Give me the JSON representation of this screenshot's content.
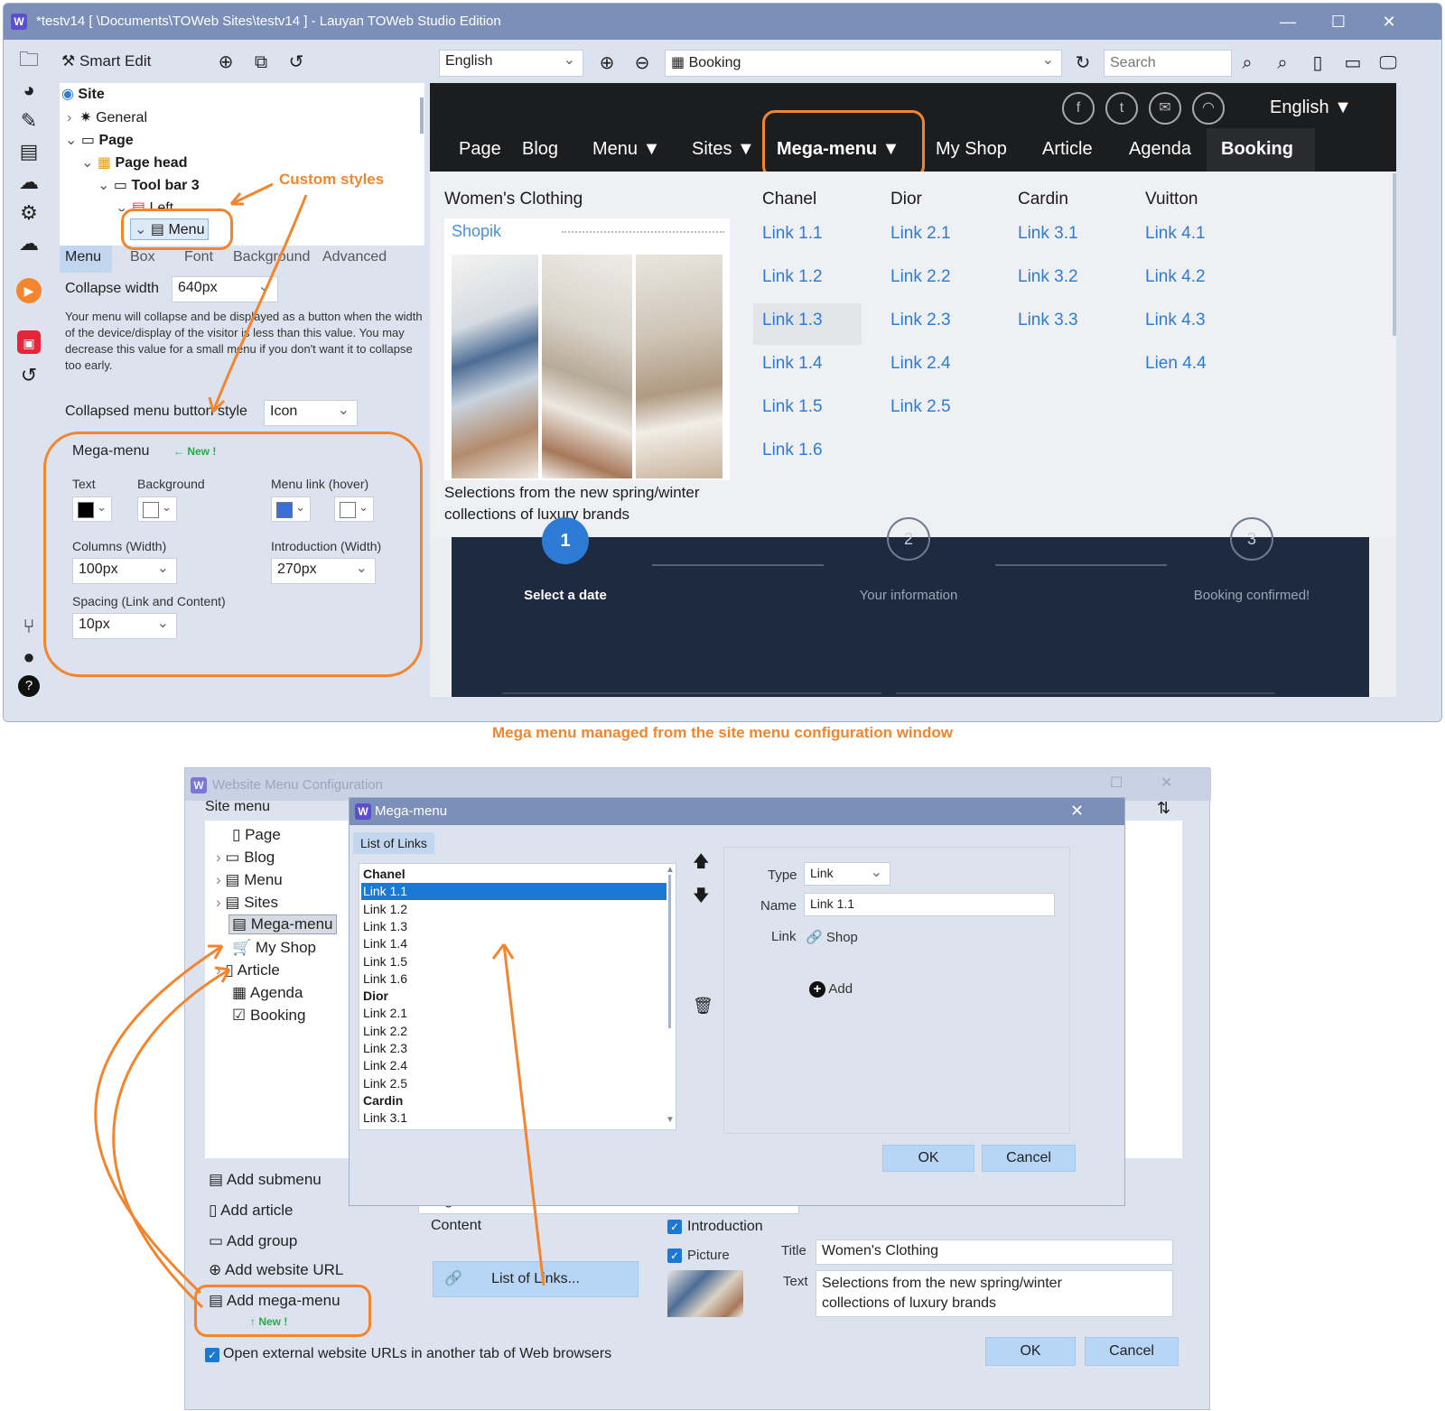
{
  "top_window": {
    "title": "*testv14 [ \\Documents\\TOWeb Sites\\testv14 ] - Lauyan TOWeb Studio Edition",
    "window_controls": [
      "—",
      "☐",
      "✕"
    ],
    "toolbar": {
      "smart_edit": "Smart Edit",
      "language": "English",
      "page_select": "Booking",
      "search_placeholder": "Search"
    },
    "tree": {
      "site": "Site",
      "general": "General",
      "page": "Page",
      "page_head": "Page head",
      "tool_bar": "Tool bar 3",
      "left": "Left",
      "menu": "Menu"
    },
    "tabs": [
      "Menu",
      "Box",
      "Font",
      "Background",
      "Advanced"
    ],
    "collapse_width_label": "Collapse width",
    "collapse_width_value": "640px",
    "collapse_help": "Your menu will collapse and be displayed as a button when the width of the device/display of the visitor is less than this value. You may decrease this value for a small menu if you don't want it to collapse too early.",
    "collapsed_style_label": "Collapsed menu button style",
    "collapsed_style_value": "Icon",
    "mega": {
      "title": "Mega-menu",
      "new_badge": "← New !",
      "text_label": "Text",
      "background_label": "Background",
      "hover_label": "Menu link (hover)",
      "columns_label": "Columns (Width)",
      "columns_value": "100px",
      "intro_label": "Introduction (Width)",
      "intro_value": "270px",
      "spacing_label": "Spacing (Link and Content)",
      "spacing_value": "10px",
      "colors": {
        "text": "#000000",
        "background": "#ffffff",
        "hover": "#3a6fd8",
        "hover_bg": "#ffffff"
      }
    },
    "annotation_custom_styles": "Custom styles"
  },
  "preview": {
    "language": "English ▼",
    "social_icons": [
      "facebook-icon",
      "twitter-icon",
      "mail-icon",
      "rss-icon"
    ],
    "nav": [
      "Page",
      "Blog",
      "Menu ▼",
      "Sites ▼",
      "Mega-menu ▼",
      "My Shop",
      "Article",
      "Agenda",
      "Booking"
    ],
    "intro_title": "Women's Clothing",
    "intro_brand": "Shopik",
    "intro_text_1": "Selections from the new spring/winter",
    "intro_text_2": "collections of luxury brands",
    "columns": [
      {
        "name": "Chanel",
        "links": [
          "Link 1.1",
          "Link 1.2",
          "Link 1.3",
          "Link 1.4",
          "Link 1.5",
          "Link 1.6"
        ]
      },
      {
        "name": "Dior",
        "links": [
          "Link 2.1",
          "Link 2.2",
          "Link 2.3",
          "Link 2.4",
          "Link 2.5"
        ]
      },
      {
        "name": "Cardin",
        "links": [
          "Link 3.1",
          "Link 3.2",
          "Link 3.3"
        ]
      },
      {
        "name": "Vuitton",
        "links": [
          "Link 4.1",
          "Link 4.2",
          "Link 4.3",
          "Lien 4.4"
        ]
      }
    ],
    "steps": [
      {
        "num": "1",
        "label": "Select a date"
      },
      {
        "num": "2",
        "label": "Your information"
      },
      {
        "num": "3",
        "label": "Booking confirmed!"
      }
    ],
    "accent": "#2e7bd6"
  },
  "caption": "Mega menu managed from the site menu configuration window",
  "config_window": {
    "title": "Website Menu Configuration",
    "site_menu_label": "Site menu",
    "site_menu": [
      "Page",
      "Blog",
      "Menu",
      "Sites",
      "Mega-menu",
      "My Shop",
      "Article",
      "Agenda",
      "Booking"
    ],
    "actions": [
      "Add submenu",
      "Add article",
      "Add group",
      "Add website URL",
      "Add mega-menu"
    ],
    "new_badge": "↑ New !",
    "name_value": "Mega-menu",
    "content_label": "Content",
    "list_button": "List of Links...",
    "introduction_label": "Introduction",
    "picture_label": "Picture",
    "title_label": "Title",
    "title_value": "Women's Clothing",
    "text_label": "Text",
    "text_value_1": "Selections from the new spring/winter",
    "text_value_2": "collections of luxury brands",
    "open_external": "Open external website URLs in another tab of Web browsers",
    "ok": "OK",
    "cancel": "Cancel"
  },
  "mega_dialog": {
    "title": "Mega-menu",
    "tab": "List of Links",
    "list": [
      {
        "text": "Chanel",
        "bold": true
      },
      {
        "text": "Link 1.1",
        "selected": true
      },
      {
        "text": "Link 1.2"
      },
      {
        "text": "Link 1.3"
      },
      {
        "text": "Link 1.4"
      },
      {
        "text": "Link 1.5"
      },
      {
        "text": "Link 1.6"
      },
      {
        "text": "Dior",
        "bold": true
      },
      {
        "text": "Link 2.1"
      },
      {
        "text": "Link 2.2"
      },
      {
        "text": "Link 2.3"
      },
      {
        "text": "Link 2.4"
      },
      {
        "text": "Link 2.5"
      },
      {
        "text": "Cardin",
        "bold": true
      },
      {
        "text": "Link 3.1"
      }
    ],
    "type_label": "Type",
    "type_value": "Link",
    "name_label": "Name",
    "name_value": "Link 1.1",
    "link_label": "Link",
    "link_value": "Shop",
    "add_label": "Add",
    "ok": "OK",
    "cancel": "Cancel"
  }
}
